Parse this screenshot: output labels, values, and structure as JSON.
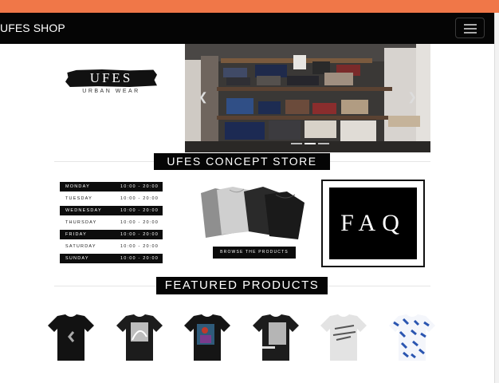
{
  "navbar": {
    "brand": "UFES SHOP",
    "menu_icon": "hamburger-menu-icon"
  },
  "logo": {
    "title": "UFES",
    "subtitle": "URBAN WEAR"
  },
  "carousel": {
    "prev_icon": "chevron-left-icon",
    "next_icon": "chevron-right-icon"
  },
  "concept_store": {
    "heading": "UFES CONCEPT STORE",
    "hours": [
      {
        "day": "MONDAY",
        "time": "10:00 - 20:00"
      },
      {
        "day": "TUESDAY",
        "time": "10:00 - 20:00"
      },
      {
        "day": "WEDNESDAY",
        "time": "10:00 - 20:00"
      },
      {
        "day": "THURSDAY",
        "time": "10:00 - 20:00"
      },
      {
        "day": "FRIDAY",
        "time": "10:00 - 20:00"
      },
      {
        "day": "SATURDAY",
        "time": "10:00 - 20:00"
      },
      {
        "day": "SUNDAY",
        "time": "10:00 - 20:00"
      }
    ],
    "browse_label": "BROWSE THE PRODUCTS",
    "faq_label": "FAQ"
  },
  "featured": {
    "heading": "FEATURED PRODUCTS"
  },
  "colors": {
    "accent": "#f07748",
    "nav_bg": "#050505"
  }
}
